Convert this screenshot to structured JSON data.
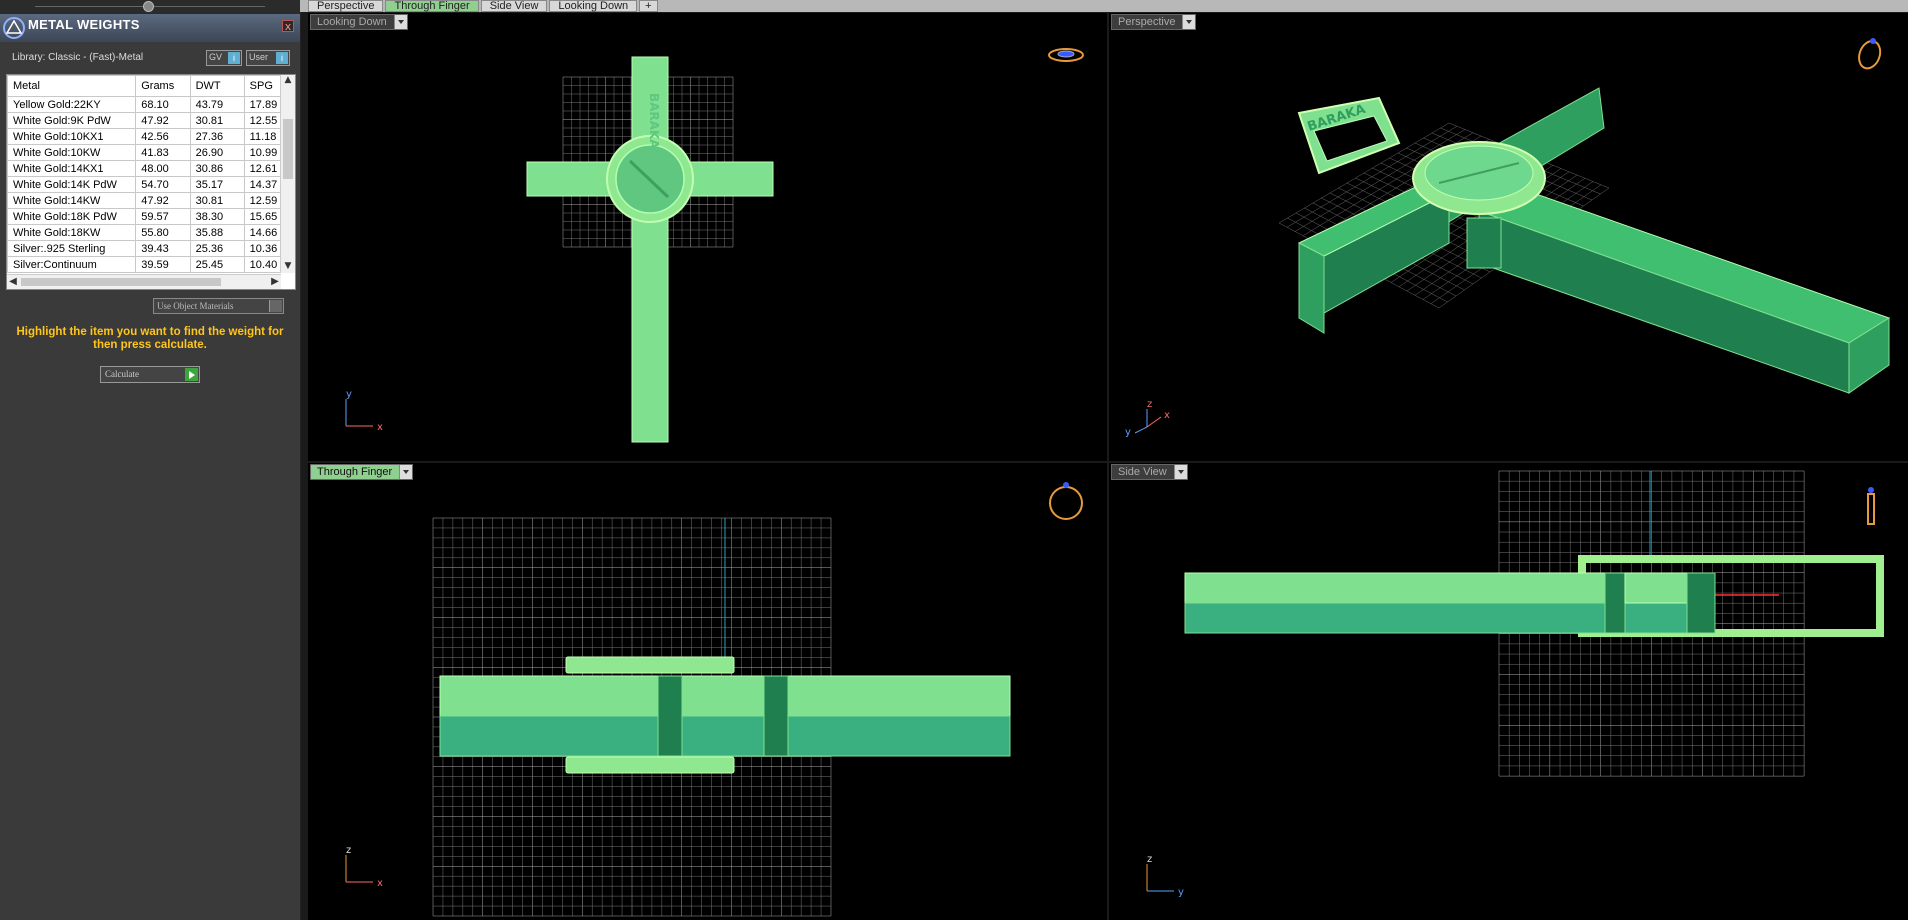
{
  "panel": {
    "title": "METAL WEIGHTS",
    "close_label": "x",
    "library_label": "Library: Classic - (Fast)-Metal",
    "gv_label": "GV",
    "user_label": "User",
    "indicator_label": "i",
    "table": {
      "columns": [
        "Metal",
        "Grams",
        "DWT",
        "SPG"
      ],
      "rows": [
        [
          "Yellow Gold:22KY",
          "68.10",
          "43.79",
          "17.89"
        ],
        [
          "White Gold:9K PdW",
          "47.92",
          "30.81",
          "12.55"
        ],
        [
          "White Gold:10KX1",
          "42.56",
          "27.36",
          "11.18"
        ],
        [
          "White Gold:10KW",
          "41.83",
          "26.90",
          "10.99"
        ],
        [
          "White Gold:14KX1",
          "48.00",
          "30.86",
          "12.61"
        ],
        [
          "White Gold:14K PdW",
          "54.70",
          "35.17",
          "14.37"
        ],
        [
          "White Gold:14KW",
          "47.92",
          "30.81",
          "12.59"
        ],
        [
          "White Gold:18K PdW",
          "59.57",
          "38.30",
          "15.65"
        ],
        [
          "White Gold:18KW",
          "55.80",
          "35.88",
          "14.66"
        ],
        [
          "Silver:.925 Sterling",
          "39.43",
          "25.36",
          "10.36"
        ],
        [
          "Silver:Continuum",
          "39.59",
          "25.45",
          "10.40"
        ]
      ]
    },
    "use_object_materials_label": "Use Object Materials",
    "hint": "Highlight the item you want to find the weight for then press calculate.",
    "calculate_label": "Calculate"
  },
  "tabs": [
    {
      "label": "Perspective",
      "active": false
    },
    {
      "label": "Through Finger",
      "active": true
    },
    {
      "label": "Side View",
      "active": false
    },
    {
      "label": "Looking Down",
      "active": false
    }
  ],
  "tab_add_label": "+",
  "viewports": {
    "top_left": {
      "label": "Looking Down",
      "axis1": "y",
      "axis2": "x"
    },
    "top_right": {
      "label": "Perspective",
      "axis1": "z",
      "axis2": "y",
      "axis3": "x"
    },
    "bottom_left": {
      "label": "Through Finger",
      "axis1": "z",
      "axis2": "x"
    },
    "bottom_right": {
      "label": "Side View",
      "axis1": "z",
      "axis2": "y"
    }
  },
  "model_text": "BARAKA",
  "colors": {
    "model_light": "#7fe08f",
    "model_mid": "#3fbf6f",
    "model_dark": "#1f7f4f",
    "grid": "#7a7a7a",
    "hint": "#ffc61a",
    "ring_icon": "#e89a3a"
  }
}
